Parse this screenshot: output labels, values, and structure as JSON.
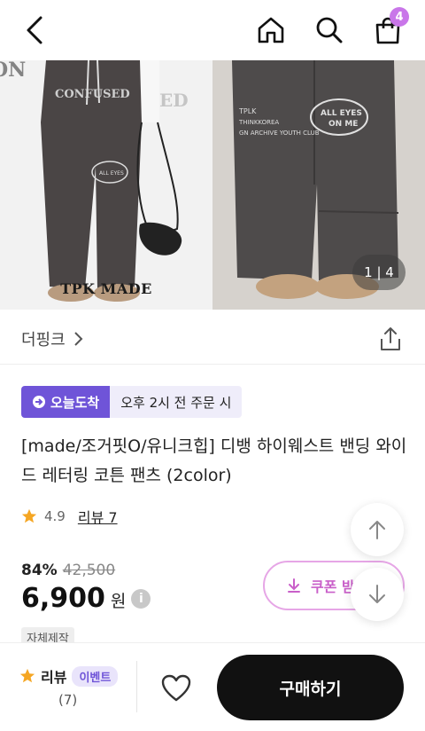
{
  "header": {
    "cart_count": "4"
  },
  "hero": {
    "left_caption": "TPK MADE",
    "counter": "1 | 4"
  },
  "brand": {
    "name": "더핑크"
  },
  "delivery": {
    "tag": "오늘도착",
    "time": "오후 2시 전 주문 시"
  },
  "product": {
    "title": "[made/조거핏O/유니크힙] 디뱅 하이웨스트 밴딩 와이드 레터링 코튼 팬츠 (2color)",
    "rating": "4.9",
    "review_link": "리뷰 7",
    "discount_pct": "84%",
    "original_price": "42,500",
    "price": "6,900",
    "currency": "원",
    "chip": "자체제작"
  },
  "coupon": {
    "label": "쿠폰 받"
  },
  "bottom_bar": {
    "review_label": "리뷰",
    "event_badge": "이벤트",
    "review_count": "(7)",
    "buy_label": "구매하기"
  },
  "colors": {
    "accent_purple": "#6f54d8",
    "badge_pink": "#c976e9",
    "coupon_pink": "#c95fc9",
    "star": "#f5a623",
    "buy_button": "#111111"
  }
}
